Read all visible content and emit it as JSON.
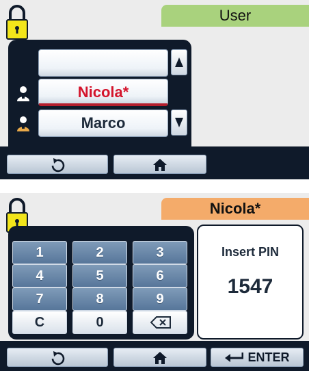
{
  "screen_user": {
    "title": "User",
    "users": [
      {
        "name": ""
      },
      {
        "name": "Nicola*"
      },
      {
        "name": "Marco"
      }
    ]
  },
  "screen_pin": {
    "title": "Nicola*",
    "keys": [
      "1",
      "2",
      "3",
      "4",
      "5",
      "6",
      "7",
      "8",
      "9",
      "C",
      "0"
    ],
    "pin_label": "Insert PIN",
    "pin_value": "1547",
    "enter_label": "ENTER"
  },
  "colors": {
    "dark_bg": "#0f1a2a",
    "user_tab": "#a9d27d",
    "pin_tab": "#f4ab6a",
    "lock_yellow": "#f2e51a",
    "selected_text": "#d4142b"
  },
  "icons": [
    "padlock-icon",
    "user-icon",
    "scroll-up-icon",
    "scroll-down-icon",
    "back-arrow-icon",
    "home-icon",
    "backspace-icon",
    "enter-arrow-icon"
  ]
}
